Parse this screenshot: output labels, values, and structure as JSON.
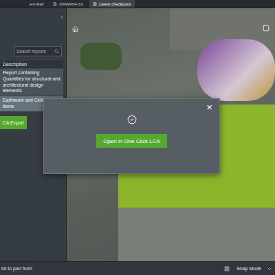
{
  "tabs": [
    {
      "label": "ent Rail",
      "selected": false
    },
    {
      "label": "DRWR04-S3",
      "selected": false
    },
    {
      "label": "Latest checkpoint",
      "selected": true
    }
  ],
  "search": {
    "placeholder": "Search reports"
  },
  "table": {
    "columns": [
      "Description"
    ],
    "rows": [
      {
        "text": "Report containing Quantities for structural and architectural design elements",
        "selected": false
      },
      {
        "text": "Earthwork and Civil design items",
        "selected": true
      }
    ]
  },
  "export_button": "CA Export",
  "dialog": {
    "close": "×",
    "button": "Open in One Click LCA"
  },
  "status_bar": {
    "hint": "int to pan from",
    "snap_mode": "Snap Mode"
  }
}
